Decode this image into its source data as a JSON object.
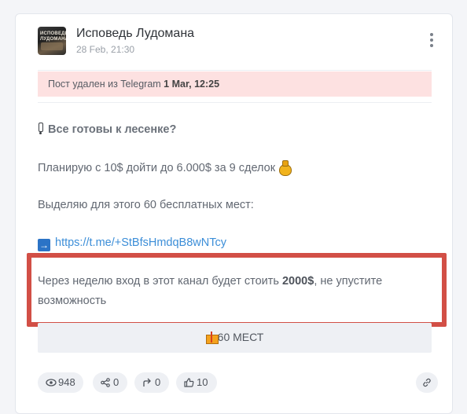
{
  "post": {
    "channel_name": "Исповедь Лудомана",
    "avatar_text": "ИСПОВЕДЬ ЛУДОМАНА",
    "date": "28 Feb, 21:30",
    "deleted_prefix": "Пост удален из Telegram ",
    "deleted_date": "1 Mar, 12:25",
    "title": "Все готовы к лесенке?",
    "line2": "Планирую с 10$ дойти до 6.000$ за 9 сделок",
    "line3": "Выделяю для этого 60 бесплатных мест:",
    "link": "https://t.me/+StBfsHmdqB8wNTcy",
    "line5_prefix": "Через неделю вход в этот канал будет стоить ",
    "line5_price": "2000$",
    "line5_suffix": ", не упустите",
    "line6": "возможность",
    "button_label": "60 МЕСТ"
  },
  "stats": {
    "views": "948",
    "shares": "0",
    "forwards": "0",
    "likes": "10"
  },
  "icons": [
    "more-vertical-icon",
    "exclamation-icon",
    "money-bag-icon",
    "arrow-right-icon",
    "gift-icon",
    "eye-icon",
    "share-icon",
    "forward-icon",
    "thumbs-up-icon",
    "link-icon"
  ],
  "colors": {
    "deleted_banner_bg": "#fde1e1",
    "highlight_border": "#d24f46",
    "link": "#3c8ed8"
  }
}
